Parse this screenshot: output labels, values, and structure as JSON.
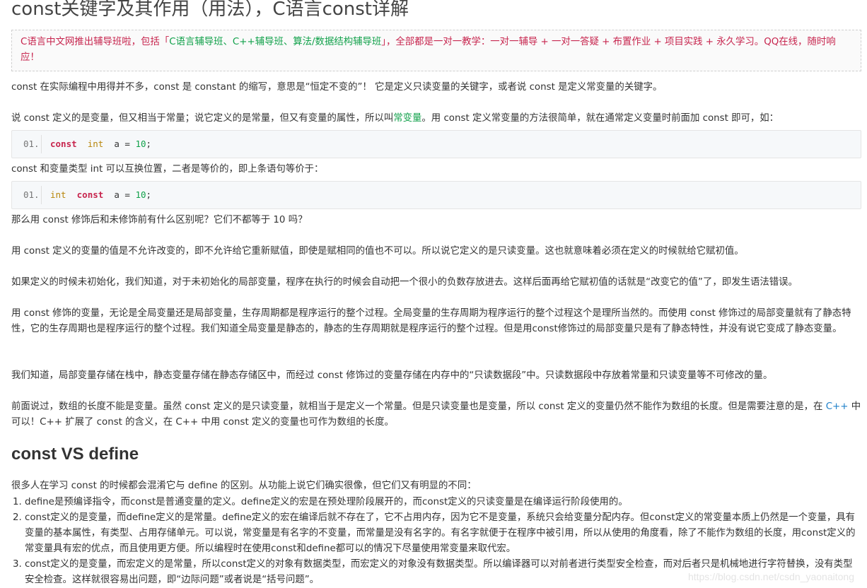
{
  "title": "const关键字及其作用（用法），C语言const详解",
  "notice": {
    "part1": "C语言中文网推出辅导班啦，包括「",
    "courses": "C语言辅导班、C++辅导班、算法/数据结构辅导班",
    "part2": "」，全部都是一对一教学：一对一辅导 + 一对一答疑 + 布置作业 + 项目实践 + 永久学习。QQ在线，随时响应！"
  },
  "paragraphs": {
    "p1": "const 在实际编程中用得并不多，const 是 constant 的缩写，意思是“恒定不变的”！ 它是定义只读变量的关键字，或者说 const 是定义常变量的关键字。",
    "p2a": "说 const 定义的是变量，但又相当于常量；说它定义的是常量，但又有变量的属性，所以叫",
    "p2link": "常变量",
    "p2b": "。用 const 定义常变量的方法很简单，就在通常定义变量时前面加 const 即可，如：",
    "p3": "const 和变量类型 int 可以互换位置，二者是等价的，即上条语句等价于：",
    "p4": "那么用 const 修饰后和未修饰前有什么区别呢？它们不都等于 10 吗？",
    "p5": "用 const 定义的变量的值是不允许改变的，即不允许给它重新赋值，即使是赋相同的值也不可以。所以说它定义的是只读变量。这也就意味着必须在定义的时候就给它赋初值。",
    "p6": "如果定义的时候未初始化，我们知道，对于未初始化的局部变量，程序在执行的时候会自动把一个很小的负数存放进去。这样后面再给它赋初值的话就是“改变它的值”了，即发生语法错误。",
    "p7": "用 const 修饰的变量，无论是全局变量还是局部变量，生存周期都是程序运行的整个过程。全局变量的生存周期为程序运行的整个过程这个是理所当然的。而使用 const 修饰过的局部变量就有了静态特性，它的生存周期也是程序运行的整个过程。我们知道全局变量是静态的，静态的生存周期就是程序运行的整个过程。但是用const修饰过的局部变量只是有了静态特性，并没有说它变成了静态变量。",
    "p8": "我们知道，局部变量存储在栈中，静态变量存储在静态存储区中，而经过 const 修饰过的变量存储在内存中的“只读数据段”中。只读数据段中存放着常量和只读变量等不可修改的量。",
    "p9a": "前面说过，数组的长度不能是变量。虽然 const 定义的是只读变量，就相当于是定义一个常量。但是只读变量也是变量，所以 const 定义的变量仍然不能作为数组的长度。但是需要注意的是，在 ",
    "p9link": "C++",
    "p9b": " 中可以！C++ 扩展了 const 的含义，在 C++ 中用 const 定义的变量也可作为数组的长度。",
    "p10": "很多人在学习 const 的时候都会混淆它与 define 的区别。从功能上说它们确实很像，但它们又有明显的不同："
  },
  "code1": {
    "line_no": "01.",
    "kw": "const",
    "type": "int",
    "rest": "  a = ",
    "num": "10",
    "end": ";"
  },
  "code2": {
    "line_no": "01.",
    "type": "int",
    "kw": "const",
    "rest": "  a = ",
    "num": "10",
    "end": ";"
  },
  "section_title": "const VS define",
  "list": [
    "define是预编译指令，而const是普通变量的定义。define定义的宏是在预处理阶段展开的，而const定义的只读变量是在编译运行阶段使用的。",
    "const定义的是变量，而define定义的是常量。define定义的宏在编译后就不存在了，它不占用内存，因为它不是变量，系统只会给变量分配内存。但const定义的常变量本质上仍然是一个变量，具有变量的基本属性，有类型、占用存储单元。可以说，常变量是有名字的不变量，而常量是没有名字的。有名字就便于在程序中被引用，所以从使用的角度看，除了不能作为数组的长度，用const定义的常变量具有宏的优点，而且使用更方便。所以编程时在使用const和define都可以的情况下尽量使用常变量来取代宏。",
    "const定义的是变量，而宏定义的是常量，所以const定义的对象有数据类型，而宏定义的对象没有数据类型。所以编译器可以对前者进行类型安全检查，而对后者只是机械地进行字符替换，没有类型安全检查。这样就很容易出问题，即“边际问题”或者说是“括号问题”。"
  ],
  "watermark": "https://blog.csdn.net/csdn_yaonaitong"
}
